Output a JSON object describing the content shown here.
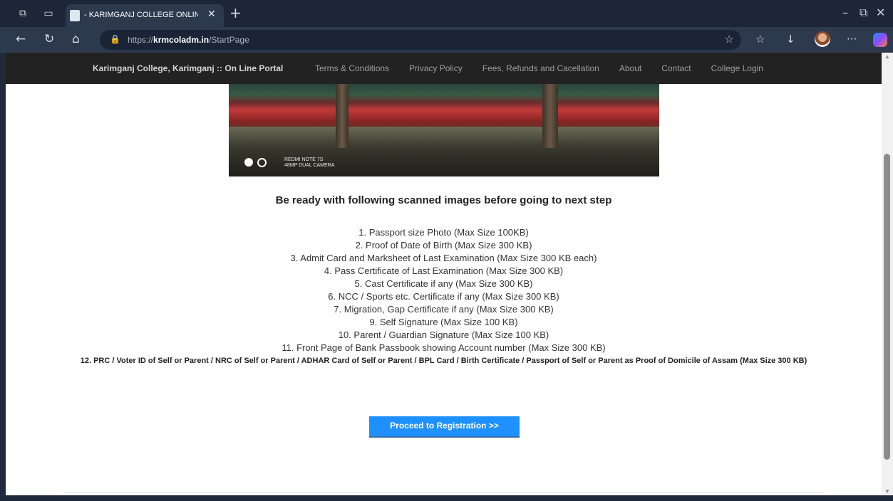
{
  "browser": {
    "tab_title": "- KARIMGANJ COLLEGE ONLINE F",
    "url_prefix": "https://",
    "url_domain": "krmcoladm.in",
    "url_path": "/StartPage"
  },
  "navbar": {
    "brand": "Karimganj College, Karimganj :: On Line Portal",
    "links": [
      "Terms & Conditions",
      "Privacy Policy",
      "Fees, Refunds and Cacellation",
      "About",
      "Contact",
      "College Login"
    ]
  },
  "photo": {
    "watermark_line1": "REDMI NOTE 7S",
    "watermark_line2": "48MP DUAL CAMERA"
  },
  "main": {
    "heading": "Be ready with following scanned images before going to next step",
    "items": [
      "1. Passport size Photo (Max Size 100KB)",
      "2. Proof of Date of Birth (Max Size 300 KB)",
      "3. Admit Card and Marksheet of Last Examination (Max Size 300 KB each)",
      "4. Pass Certificate of Last Examination (Max Size 300 KB)",
      "5. Cast Certificate if any (Max Size 300 KB)",
      "6. NCC / Sports etc. Certificate if any (Max Size 300 KB)",
      "7. Migration, Gap Certificate if any (Max Size 300 KB)",
      "9. Self Signature (Max Size 100 KB)",
      "10. Parent / Guardian Signature (Max Size 100 KB)",
      "11. Front Page of Bank Passbook showing Account number (Max Size 300 KB)"
    ],
    "item_12": "12. PRC / Voter ID of Self or Parent / NRC of Self or Parent / ADHAR Card of Self or Parent / BPL Card / Birth Certificate / Passport  of Self or Parent  as Proof of Domicile of Assam (Max Size 300 KB)",
    "proceed_label": "Proceed to Registration >>"
  }
}
